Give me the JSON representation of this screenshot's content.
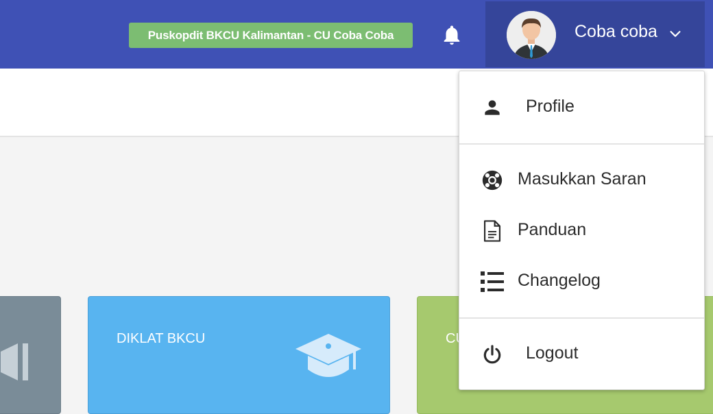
{
  "header": {
    "organization": "Puskopdit BKCU Kalimantan - CU Coba Coba",
    "user_name": "Coba coba",
    "icons": {
      "notifications": "bell-icon",
      "user_menu": "chevron-down-icon",
      "avatar": "user-avatar"
    }
  },
  "cards": [
    {
      "title": "",
      "color": "#7a8c98",
      "icon": "speaker-icon"
    },
    {
      "title": "DIKLAT BKCU",
      "color": "#58b4f0",
      "icon": "graduation-cap-icon"
    },
    {
      "title": "CU",
      "color": "#a6c96e",
      "icon": ""
    }
  ],
  "user_menu": {
    "items": [
      {
        "label": "Profile",
        "icon": "person-icon"
      },
      {
        "label": "Masukkan Saran",
        "icon": "lifebuoy-icon"
      },
      {
        "label": "Panduan",
        "icon": "document-icon"
      },
      {
        "label": "Changelog",
        "icon": "list-icon"
      },
      {
        "label": "Logout",
        "icon": "power-icon"
      }
    ]
  },
  "colors": {
    "topbar": "#3f51b5",
    "user_toggle": "#35459a",
    "badge": "#7cbd72"
  }
}
